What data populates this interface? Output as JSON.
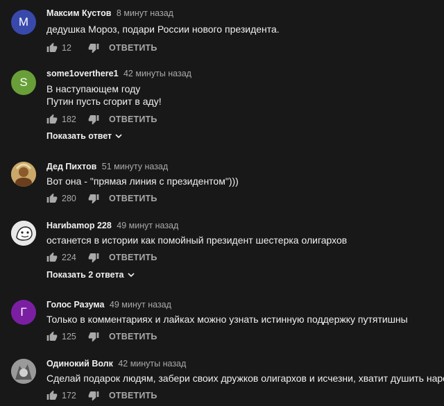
{
  "reply_label": "ОТВЕТИТЬ",
  "comments": [
    {
      "author": "Максим Кустов",
      "time": "8 минут назад",
      "lines": [
        "дедушка Мороз, подари России нового президента."
      ],
      "likes": "12",
      "avatar": {
        "letter": "М",
        "color": "#3949ab"
      }
    },
    {
      "author": "some1overthere1",
      "time": "42 минуты назад",
      "lines": [
        "В наступающем году",
        "Путин пусть сгорит в аду!"
      ],
      "likes": "182",
      "avatar": {
        "letter": "S",
        "color": "#689f38"
      },
      "show_replies": "Показать ответ"
    },
    {
      "author": "Дед Пихтов",
      "time": "51 минуту назад",
      "lines": [
        "Вот она - \"прямая линия с президентом\")))"
      ],
      "likes": "280",
      "avatar": {
        "letter": "",
        "color": "#b89a55"
      }
    },
    {
      "author": "Harиbamop 228",
      "time": "49 минут назад",
      "lines": [
        "останется в истории как помойный президент шестерка олигархов"
      ],
      "likes": "224",
      "avatar": {
        "letter": "",
        "color": "#e8e8e8"
      },
      "show_replies": "Показать 2 ответа"
    },
    {
      "author": "Голос Разума",
      "time": "49 минут назад",
      "lines": [
        "Только в комментариях и лайках можно узнать истинную поддержку путятишны"
      ],
      "likes": "125",
      "avatar": {
        "letter": "Г",
        "color": "#7b1fa2"
      }
    },
    {
      "author": "Одинокий Волк",
      "time": "42 минуты назад",
      "lines": [
        "Сделай подарок людям, забери своих дружков олигархов и исчезни, хватит душить народ"
      ],
      "likes": "172",
      "avatar": {
        "letter": "",
        "color": "#8a8a8a"
      }
    }
  ]
}
